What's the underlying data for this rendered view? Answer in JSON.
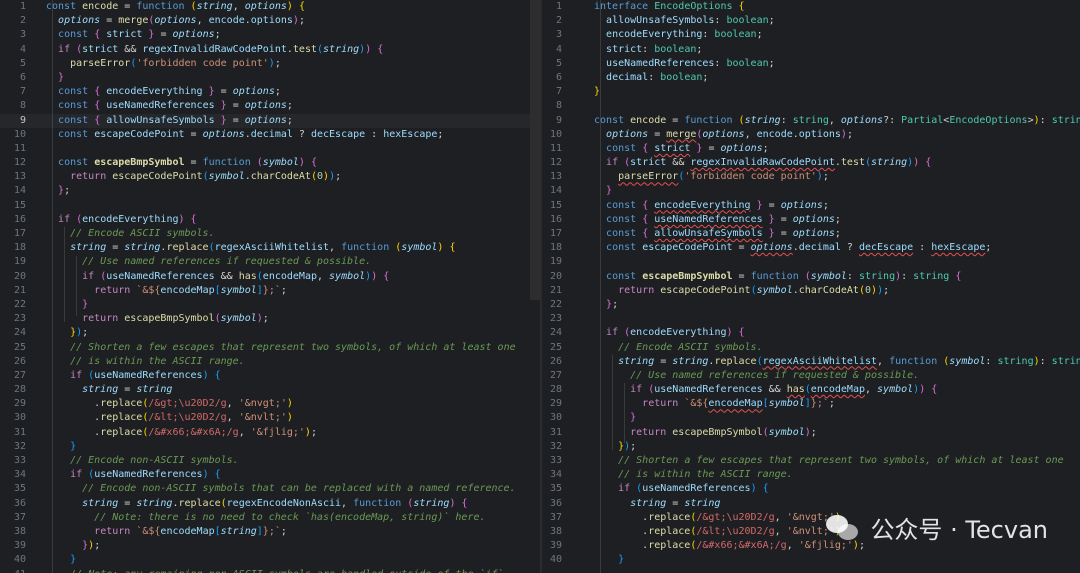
{
  "left_code": {
    "line_numbers": [
      "1",
      "2",
      "3",
      "4",
      "5",
      "6",
      "7",
      "8",
      "9",
      "10",
      "11",
      "12",
      "13",
      "14",
      "15",
      "16",
      "17",
      "18",
      "19",
      "20",
      "21",
      "22",
      "23",
      "24",
      "25",
      "26",
      "27",
      "28",
      "29",
      "30",
      "31",
      "32",
      "33",
      "34",
      "35",
      "36",
      "37",
      "38",
      "39",
      "40",
      "41"
    ],
    "current_line": "9",
    "lines": [
      "const encode = function (string, options) {",
      "  options = merge(options, encode.options);",
      "  const { strict } = options;",
      "  if (strict && regexInvalidRawCodePoint.test(string)) {",
      "    parseError('forbidden code point');",
      "  }",
      "  const { encodeEverything } = options;",
      "  const { useNamedReferences } = options;",
      "  const { allowUnsafeSymbols } = options;",
      "  const escapeCodePoint = options.decimal ? decEscape : hexEscape;",
      "",
      "  const escapeBmpSymbol = function (symbol) {",
      "    return escapeCodePoint(symbol.charCodeAt(0));",
      "  };",
      "",
      "  if (encodeEverything) {",
      "    // Encode ASCII symbols.",
      "    string = string.replace(regexAsciiWhitelist, function (symbol) {",
      "      // Use named references if requested & possible.",
      "      if (useNamedReferences && has(encodeMap, symbol)) {",
      "        return `&${encodeMap[symbol]};`;",
      "      }",
      "      return escapeBmpSymbol(symbol);",
      "    });",
      "    // Shorten a few escapes that represent two symbols, of which at least one",
      "    // is within the ASCII range.",
      "    if (useNamedReferences) {",
      "      string = string",
      "        .replace(/&gt;\\u20D2/g, '&nvgt;')",
      "        .replace(/&lt;\\u20D2/g, '&nvlt;')",
      "        .replace(/&#x66;&#x6A;/g, '&fjlig;');",
      "    }",
      "    // Encode non-ASCII symbols.",
      "    if (useNamedReferences) {",
      "      // Encode non-ASCII symbols that can be replaced with a named reference.",
      "      string = string.replace(regexEncodeNonAscii, function (string) {",
      "        // Note: there is no need to check `has(encodeMap, string)` here.",
      "        return `&${encodeMap[string]};`;",
      "      });",
      "    }",
      "    // Note: any remaining non-ASCII symbols are handled outside of the `if`."
    ]
  },
  "right_code": {
    "line_numbers": [
      "1",
      "2",
      "3",
      "4",
      "5",
      "6",
      "7",
      "8",
      "9",
      "10",
      "11",
      "12",
      "13",
      "14",
      "15",
      "16",
      "17",
      "18",
      "19",
      "20",
      "21",
      "22",
      "23",
      "24",
      "25",
      "26",
      "27",
      "28",
      "29",
      "30",
      "31",
      "32",
      "33",
      "34",
      "35",
      "36",
      "37",
      "38",
      "39",
      "40"
    ],
    "lines": [
      "interface EncodeOptions {",
      "  allowUnsafeSymbols: boolean;",
      "  encodeEverything: boolean;",
      "  strict: boolean;",
      "  useNamedReferences: boolean;",
      "  decimal: boolean;",
      "}",
      "",
      "const encode = function (string: string, options?: Partial<EncodeOptions>): string {",
      "  options = merge(options, encode.options);",
      "  const { strict } = options;",
      "  if (strict && regexInvalidRawCodePoint.test(string)) {",
      "    parseError('forbidden code point');",
      "  }",
      "  const { encodeEverything } = options;",
      "  const { useNamedReferences } = options;",
      "  const { allowUnsafeSymbols } = options;",
      "  const escapeCodePoint = options.decimal ? decEscape : hexEscape;",
      "",
      "  const escapeBmpSymbol = function (symbol: string): string {",
      "    return escapeCodePoint(symbol.charCodeAt(0));",
      "  };",
      "",
      "  if (encodeEverything) {",
      "    // Encode ASCII symbols.",
      "    string = string.replace(regexAsciiWhitelist, function (symbol: string): string {",
      "      // Use named references if requested & possible.",
      "      if (useNamedReferences && has(encodeMap, symbol)) {",
      "        return `&${encodeMap[symbol]};`;",
      "      }",
      "      return escapeBmpSymbol(symbol);",
      "    });",
      "    // Shorten a few escapes that represent two symbols, of which at least one",
      "    // is within the ASCII range.",
      "    if (useNamedReferences) {",
      "      string = string",
      "        .replace(/&gt;\\u20D2/g, '&nvgt;')",
      "        .replace(/&lt;\\u20D2/g, '&nvlt;')",
      "        .replace(/&#x66;&#x6A;/g, '&fjlig;');",
      "    }"
    ]
  },
  "watermark": {
    "label": "公众号 · Tecvan",
    "icon": "wechat-icon"
  },
  "colors": {
    "background": "#1e1f22",
    "keyword": "#569cd6",
    "string": "#ce9178",
    "comment": "#6a9955",
    "function": "#dcdcaa",
    "type": "#4ec9b0",
    "error_squiggle": "#e5504f"
  }
}
